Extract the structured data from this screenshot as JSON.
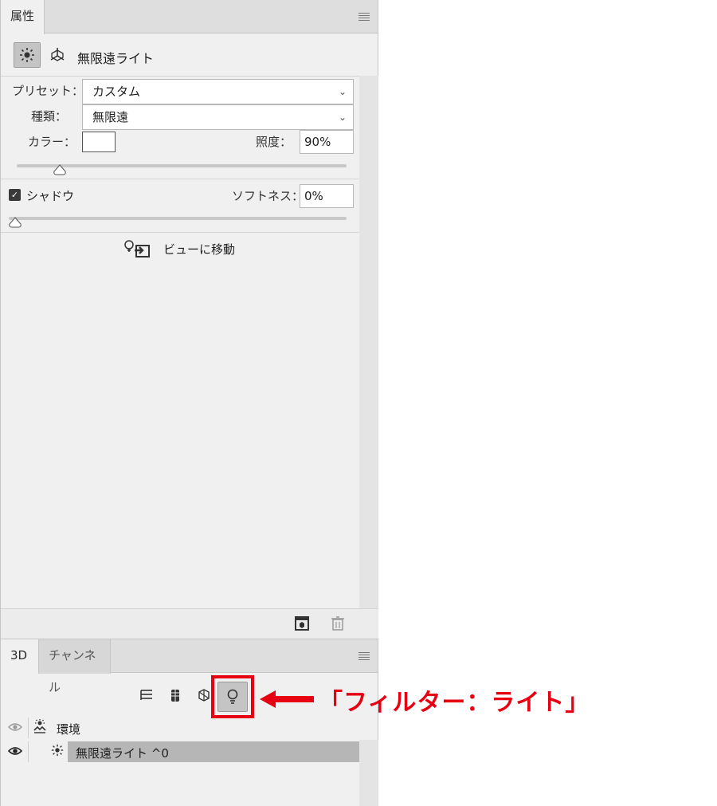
{
  "properties_panel": {
    "tab_label": "属性",
    "light_name": "無限遠ライト",
    "preset": {
      "label": "プリセット：",
      "value": "カスタム"
    },
    "type": {
      "label": "種類：",
      "value": "無限遠"
    },
    "color": {
      "label": "カラー：",
      "swatch": "#ffffff"
    },
    "intensity": {
      "label": "照度：",
      "value": "90%",
      "fraction": 0.13
    },
    "shadow": {
      "label": "シャドウ",
      "checked": true
    },
    "softness": {
      "label": "ソフトネス：",
      "value": "0%",
      "fraction": 0.0
    },
    "move_to_view_label": "ビューに移動"
  },
  "panel_3d": {
    "tabs": [
      "3D",
      "チャンネル"
    ],
    "layers": [
      {
        "name": "環境",
        "selected": false,
        "icon": "environment-icon"
      },
      {
        "name": "無限遠ライト  ^0",
        "selected": true,
        "icon": "infinite-light-icon"
      }
    ]
  },
  "annotation": {
    "text": "「フィルター：ライト」",
    "color": "#e60012"
  }
}
